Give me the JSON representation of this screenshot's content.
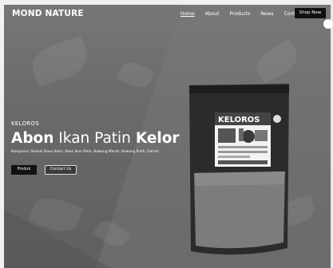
{
  "brand": "MOND NATURE",
  "nav": {
    "items": [
      "Home",
      "About",
      "Products",
      "News",
      "Contact"
    ],
    "cta": "Shop Now"
  },
  "hero": {
    "eyebrow": "KELOROS",
    "title_part1": "Abon",
    "title_part2": "Ikan Patin",
    "title_part3": "Kelor",
    "description": "Komposisi: Serbuk Daun Kelor, Abon Ikan Patin, Bawang Merah, Bawang Putih, Garam",
    "primary_button": "Produk",
    "secondary_button": "Contact Us"
  },
  "product": {
    "label": "KELOROS"
  }
}
